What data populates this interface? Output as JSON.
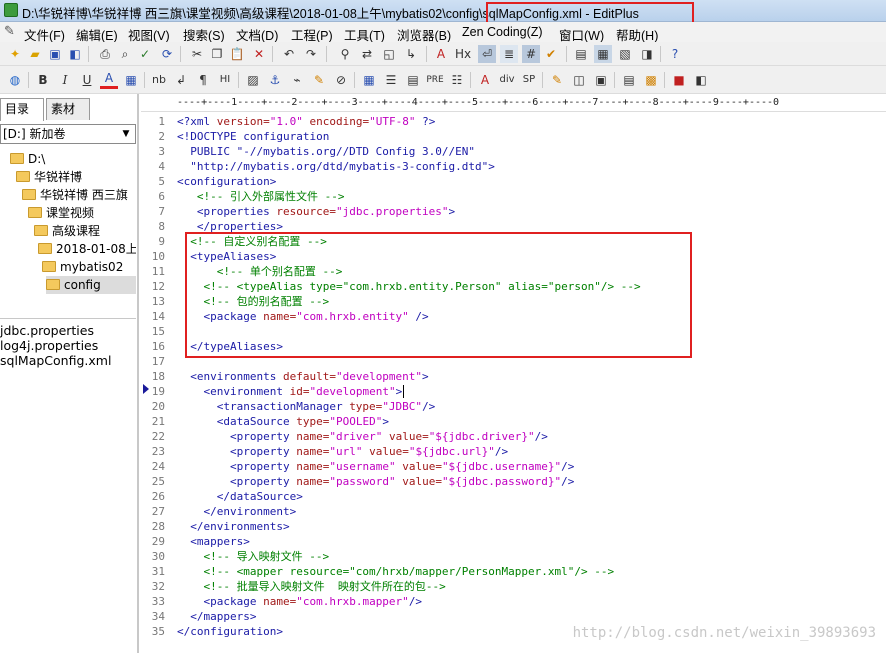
{
  "window": {
    "title_path": "D:\\华锐祥博\\华锐祥博 西三旗\\课堂视频\\高级课程\\2018-01-08上午\\mybatis02\\config\\",
    "title_file": "sqlMapConfig.xml - EditPlus"
  },
  "menu": [
    "文件(F)",
    "编辑(E)",
    "视图(V)",
    "搜索(S)",
    "文档(D)",
    "工程(P)",
    "工具(T)",
    "浏览器(B)",
    "Zen Coding(Z)",
    "窗口(W)",
    "帮助(H)"
  ],
  "toolbar2_text": {
    "nb": "nb",
    "hi": "HI",
    "pre": "PRE",
    "div": "div",
    "sp": "SP"
  },
  "sidebar": {
    "tabs": [
      "目录",
      "素材"
    ],
    "drive": "[D:] 新加卷",
    "tree": [
      "D:\\",
      "华锐祥博",
      "华锐祥博 西三旗",
      "课堂视频",
      "高级课程",
      "2018-01-08上",
      "mybatis02",
      "config"
    ],
    "files": [
      "jdbc.properties",
      "log4j.properties",
      "sqlMapConfig.xml"
    ]
  },
  "ruler": "----+----1----+----2----+----3----+----4----+----5----+----6----+----7----+----8----+----9----+----0",
  "code": [
    [
      [
        "pi",
        "<?xml "
      ],
      [
        "attr",
        "version="
      ],
      [
        "val",
        "\"1.0\""
      ],
      [
        "attr",
        " encoding="
      ],
      [
        "val",
        "\"UTF-8\""
      ],
      [
        "pi",
        " ?>"
      ]
    ],
    [
      [
        "tag",
        "<!DOCTYPE configuration"
      ]
    ],
    [
      [
        "tag",
        "  PUBLIC \"-//mybatis.org//DTD Config 3.0//EN\""
      ]
    ],
    [
      [
        "tag",
        "  \"http://mybatis.org/dtd/mybatis-3-config.dtd\">"
      ]
    ],
    [
      [
        "tag",
        "<configuration>"
      ]
    ],
    [
      [
        "com",
        "   <!-- 引入外部属性文件 -->"
      ]
    ],
    [
      [
        "tag",
        "   <properties "
      ],
      [
        "attr",
        "resource="
      ],
      [
        "val",
        "\"jdbc.properties\""
      ],
      [
        "tag",
        ">"
      ]
    ],
    [
      [
        "tag",
        "   </properties>"
      ]
    ],
    [
      [
        "com",
        "  <!-- 自定义别名配置 -->"
      ]
    ],
    [
      [
        "tag",
        "  <typeAliases>"
      ]
    ],
    [
      [
        "com",
        "      <!-- 单个别名配置 -->"
      ]
    ],
    [
      [
        "com",
        "    <!-- <typeAlias type=\"com.hrxb.entity.Person\" alias=\"person\"/> -->"
      ]
    ],
    [
      [
        "com",
        "    <!-- 包的别名配置 -->"
      ]
    ],
    [
      [
        "tag",
        "    <package "
      ],
      [
        "attr",
        "name="
      ],
      [
        "val",
        "\"com.hrxb.entity\""
      ],
      [
        "tag",
        " />"
      ]
    ],
    [
      [
        "tag",
        ""
      ]
    ],
    [
      [
        "tag",
        "  </typeAliases>"
      ]
    ],
    [
      [
        "tag",
        ""
      ]
    ],
    [
      [
        "tag",
        "  <environments "
      ],
      [
        "attr",
        "default="
      ],
      [
        "val",
        "\"development\""
      ],
      [
        "tag",
        ">"
      ]
    ],
    [
      [
        "tag",
        "    <environment "
      ],
      [
        "attr",
        "id="
      ],
      [
        "val",
        "\"development\""
      ],
      [
        "tag",
        ">"
      ]
    ],
    [
      [
        "tag",
        "      <transactionManager "
      ],
      [
        "attr",
        "type="
      ],
      [
        "val",
        "\"JDBC\""
      ],
      [
        "tag",
        "/>"
      ]
    ],
    [
      [
        "tag",
        "      <dataSource "
      ],
      [
        "attr",
        "type="
      ],
      [
        "val",
        "\"POOLED\""
      ],
      [
        "tag",
        ">"
      ]
    ],
    [
      [
        "tag",
        "        <property "
      ],
      [
        "attr",
        "name="
      ],
      [
        "val",
        "\"driver\""
      ],
      [
        "attr",
        " value="
      ],
      [
        "val",
        "\"${jdbc.driver}\""
      ],
      [
        "tag",
        "/>"
      ]
    ],
    [
      [
        "tag",
        "        <property "
      ],
      [
        "attr",
        "name="
      ],
      [
        "val",
        "\"url\""
      ],
      [
        "attr",
        " value="
      ],
      [
        "val",
        "\"${jdbc.url}\""
      ],
      [
        "tag",
        "/>"
      ]
    ],
    [
      [
        "tag",
        "        <property "
      ],
      [
        "attr",
        "name="
      ],
      [
        "val",
        "\"username\""
      ],
      [
        "attr",
        " value="
      ],
      [
        "val",
        "\"${jdbc.username}\""
      ],
      [
        "tag",
        "/>"
      ]
    ],
    [
      [
        "tag",
        "        <property "
      ],
      [
        "attr",
        "name="
      ],
      [
        "val",
        "\"password\""
      ],
      [
        "attr",
        " value="
      ],
      [
        "val",
        "\"${jdbc.password}\""
      ],
      [
        "tag",
        "/>"
      ]
    ],
    [
      [
        "tag",
        "      </dataSource>"
      ]
    ],
    [
      [
        "tag",
        "    </environment>"
      ]
    ],
    [
      [
        "tag",
        "  </environments>"
      ]
    ],
    [
      [
        "tag",
        "  <mappers>"
      ]
    ],
    [
      [
        "com",
        "    <!-- 导入映射文件 -->"
      ]
    ],
    [
      [
        "com",
        "    <!-- <mapper resource=\"com/hrxb/mapper/PersonMapper.xml\"/> -->"
      ]
    ],
    [
      [
        "com",
        "    <!-- 批量导入映射文件  映射文件所在的包-->"
      ]
    ],
    [
      [
        "tag",
        "    <package "
      ],
      [
        "attr",
        "name="
      ],
      [
        "val",
        "\"com.hrxb.mapper\""
      ],
      [
        "tag",
        "/>"
      ]
    ],
    [
      [
        "tag",
        "  </mappers>"
      ]
    ],
    [
      [
        "tag",
        "</configuration>"
      ]
    ]
  ],
  "watermark": "http://blog.csdn.net/weixin_39893693"
}
